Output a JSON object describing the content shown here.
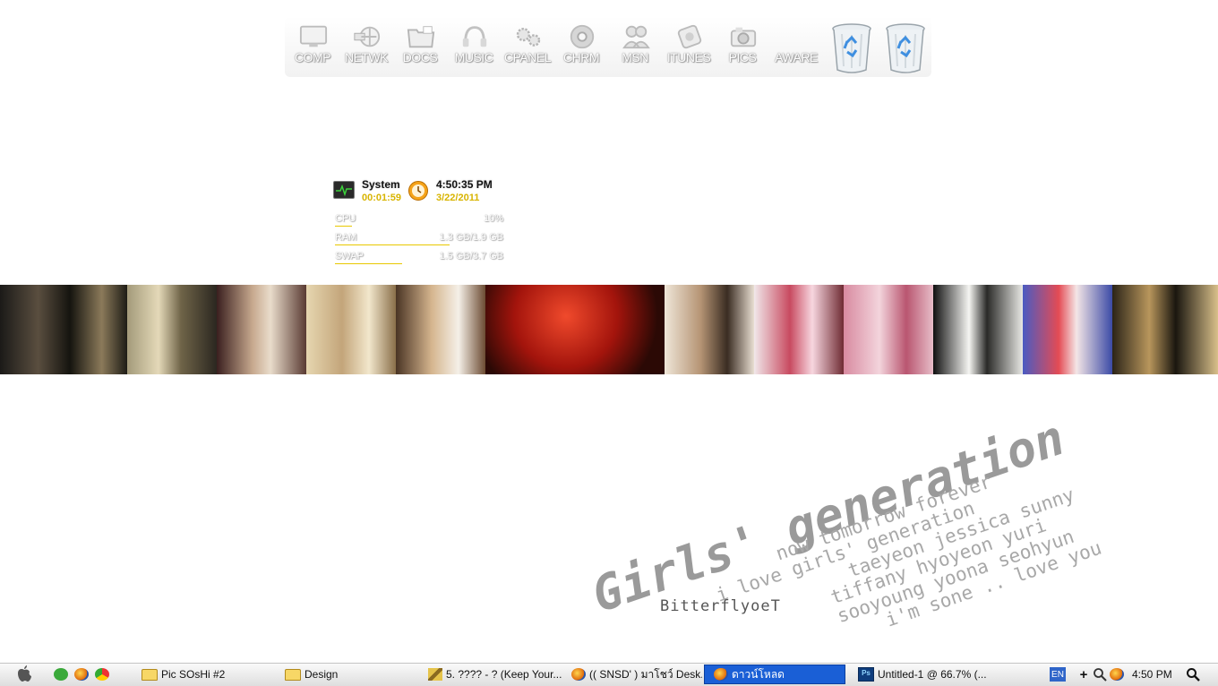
{
  "dock": {
    "items": [
      {
        "label": "COMP",
        "icon": "monitor-icon"
      },
      {
        "label": "NETWK",
        "icon": "network-icon"
      },
      {
        "label": "DOCS",
        "icon": "documents-icon"
      },
      {
        "label": "MUSIC",
        "icon": "headphones-icon"
      },
      {
        "label": "CPANEL",
        "icon": "gears-icon"
      },
      {
        "label": "CHRM",
        "icon": "chrome-icon"
      },
      {
        "label": "MSN",
        "icon": "msn-icon"
      },
      {
        "label": "ITUNES",
        "icon": "itunes-icon"
      },
      {
        "label": "PICS",
        "icon": "pictures-icon"
      },
      {
        "label": "AWARE",
        "icon": "aware-icon"
      }
    ],
    "bins": [
      "recycle-bin-icon",
      "recycle-bin-icon"
    ]
  },
  "system": {
    "title": "System",
    "uptime": "00:01:59",
    "time": "4:50:35 PM",
    "date": "3/22/2011",
    "meters": [
      {
        "name": "CPU",
        "value": "10%",
        "fill": 0.1
      },
      {
        "name": "RAM",
        "value": "1.3 GB/1.9 GB",
        "fill": 0.68
      },
      {
        "name": "SWAP",
        "value": "1.5 GB/3.7 GB",
        "fill": 0.4
      }
    ]
  },
  "art": {
    "title": "Girls' generation",
    "lines": [
      "now tomorrow forever",
      "i love girls' generation",
      "taeyeon jessica sunny",
      "tiffany hyoyeon yuri",
      "sooyoung yoona seohyun",
      "i'm sone .. love you"
    ],
    "signature": "BitterflyoeT"
  },
  "taskbar": {
    "start_icon": "apple-icon",
    "quicklaunch": [
      "utorrent-icon",
      "firefox-icon",
      "chrome-icon"
    ],
    "buttons": [
      {
        "label": "Pic SOsHi #2",
        "icon": "folder-icon"
      },
      {
        "label": "Design",
        "icon": "folder-icon"
      },
      {
        "label": "5. ???? - ? (Keep Your...",
        "icon": "pencil-icon"
      },
      {
        "label": "(( SNSD' ) มาโชว์ Desk...",
        "icon": "firefox-icon"
      },
      {
        "label": "ดาวน์โหลด",
        "icon": "firefox-icon"
      },
      {
        "label": "Untitled-1 @ 66.7% (...",
        "icon": "photoshop-icon"
      }
    ],
    "language": "EN",
    "clock": "4:50 PM"
  },
  "colors": {
    "accent_yellow": "#d8b400",
    "taskbar_active": "#1a5fd6",
    "art_gray": "#9a9a9a"
  }
}
